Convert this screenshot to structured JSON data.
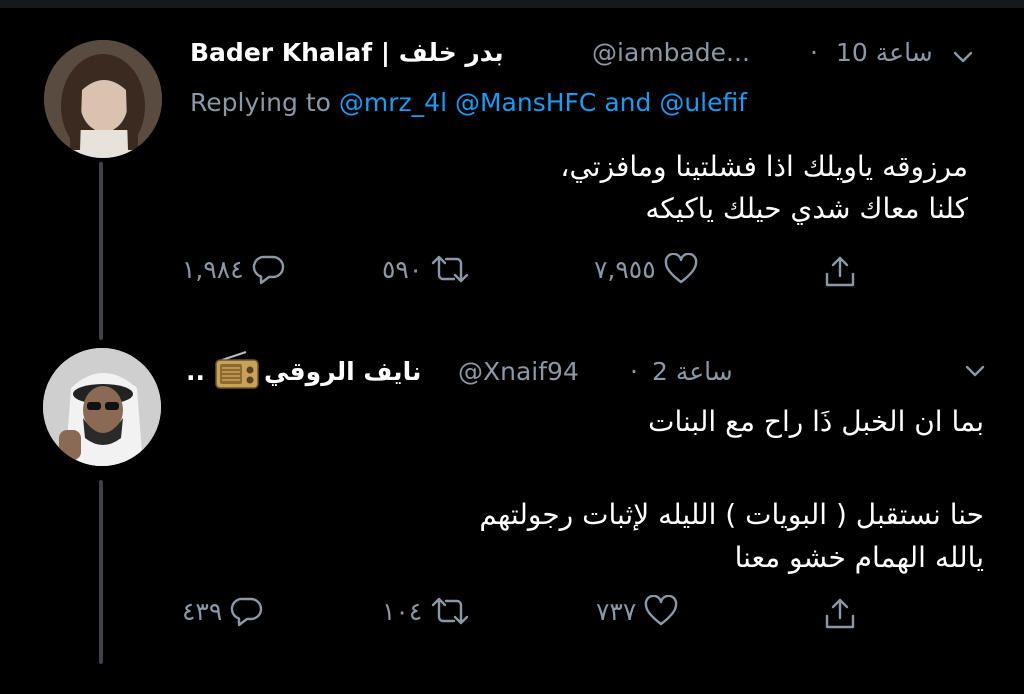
{
  "tweets": [
    {
      "display_name": "Bader Khalaf | بدر خلف",
      "handle": "@iambade...",
      "dot": "·",
      "time": "10 ساعة",
      "replying": {
        "prefix": "Replying to",
        "mentions": "@mrz_4l @MansHFC",
        "and": "and",
        "last": "@ulefif"
      },
      "text_lines": [
        "مرزوقه ياويلك اذا فشلتينا ومافزتي،",
        "كلنا معاك شدي حيلك ياكيكه"
      ],
      "counts": {
        "replies": "١,٩٨٤",
        "retweets": "٥٩٠",
        "likes": "٧,٩٥٥"
      }
    },
    {
      "display_name": "نايف الروقي",
      "name_suffix": "..",
      "handle": "@Xnaif94",
      "dot": "·",
      "time": "2 ساعة",
      "text_lines": [
        "بما ان الخبل ذَا راح مع البنات",
        "",
        "حنا نستقبل ( البويات ) الليله لإثبات رجولتهم",
        "يالله الهمام خشو معنا"
      ],
      "counts": {
        "replies": "٤٣٩",
        "retweets": "١٠٤",
        "likes": "٧٣٧"
      }
    }
  ],
  "icons": {
    "caret": "chevron-down-icon",
    "reply": "reply-icon",
    "retweet": "retweet-icon",
    "like": "heart-icon",
    "share": "share-icon",
    "radio": "radio-emoji-icon"
  },
  "colors": {
    "background": "#000000",
    "muted": "#8b98a5",
    "link": "#1d9bf0",
    "text": "#ffffff"
  }
}
